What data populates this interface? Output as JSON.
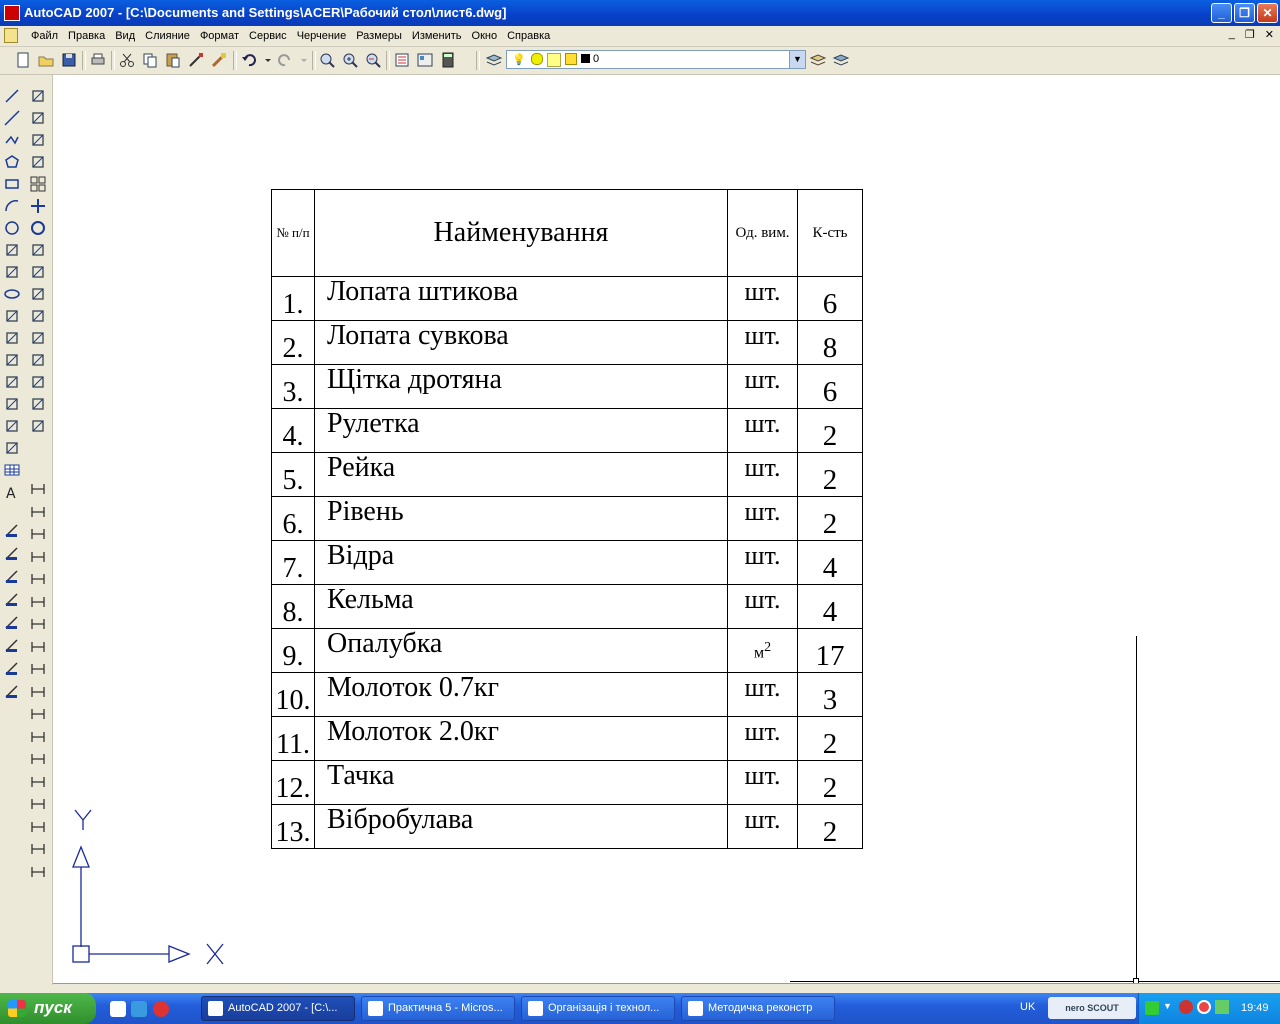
{
  "window": {
    "title": "AutoCAD 2007 - [C:\\Documents and Settings\\ACER\\Рабочий стол\\лист6.dwg]",
    "minimize": "_",
    "maximize": "❐",
    "close": "✕",
    "mdi_minimize": "_",
    "mdi_restore": "❐",
    "mdi_close": "✕"
  },
  "menu": [
    "Файл",
    "Правка",
    "Вид",
    "Слияние",
    "Формат",
    "Сервис",
    "Черчение",
    "Размеры",
    "Изменить",
    "Окно",
    "Справка"
  ],
  "toolbar": {
    "layer_value": "0",
    "icons": [
      "new-icon",
      "open-icon",
      "save-icon",
      "print-icon",
      "cut-icon",
      "copy-icon",
      "paste-icon",
      "matchprop-icon",
      "brush-icon",
      "undo-icon",
      "redo-icon",
      "pan-icon",
      "zoom-realtime-icon",
      "zoom-window-icon",
      "zoom-previous-icon",
      "properties-icon",
      "designcenter-icon",
      "calculator-icon",
      "layers-icon"
    ]
  },
  "table": {
    "header": {
      "no": "№ п/п",
      "name": "Найменування",
      "unit": "Од. вим.",
      "qty": "К-сть"
    },
    "rows": [
      {
        "no": "1.",
        "name": "Лопата штикова",
        "unit": "шт.",
        "qty": "6"
      },
      {
        "no": "2.",
        "name": "Лопата сувкова",
        "unit": "шт.",
        "qty": "8"
      },
      {
        "no": "3.",
        "name": "Щітка дротяна",
        "unit": "шт.",
        "qty": "6"
      },
      {
        "no": "4.",
        "name": "Рулетка",
        "unit": "шт.",
        "qty": "2"
      },
      {
        "no": "5.",
        "name": "Рейка",
        "unit": "шт.",
        "qty": "2"
      },
      {
        "no": "6.",
        "name": "Рівень",
        "unit": "шт.",
        "qty": "2"
      },
      {
        "no": "7.",
        "name": "Відра",
        "unit": "шт.",
        "qty": "4"
      },
      {
        "no": "8.",
        "name": "Кельма",
        "unit": "шт.",
        "qty": "4"
      },
      {
        "no": "9.",
        "name": "Опалубка",
        "unit": "м",
        "unit_sup": "2",
        "qty": "17"
      },
      {
        "no": "10.",
        "name": "Молоток 0.7кг",
        "unit": "шт.",
        "qty": "3"
      },
      {
        "no": "11.",
        "name": "Молоток 2.0кг",
        "unit": "шт.",
        "qty": "2"
      },
      {
        "no": "12.",
        "name": "Тачка",
        "unit": "шт.",
        "qty": "2"
      },
      {
        "no": "13.",
        "name": "Вібробулава",
        "unit": "шт.",
        "qty": "2"
      }
    ]
  },
  "ucs": {
    "x_label": "X",
    "y_label": "Y"
  },
  "taskbar": {
    "start_label": "пуск",
    "tasks": [
      {
        "label": "AutoCAD 2007 - [C:\\...",
        "active": true
      },
      {
        "label": "Практична 5 - Micros...",
        "active": false
      },
      {
        "label": "Організація і технол...",
        "active": false
      },
      {
        "label": "Методичка реконстр",
        "active": false
      }
    ],
    "language": "UK",
    "nero": "nero SCOUT",
    "clock": "19:49"
  },
  "colors": {
    "titlebar": "#0a5fe0",
    "taskbar": "#245edb",
    "start": "#2f8e2c",
    "ucs": "#1a2a9a"
  }
}
